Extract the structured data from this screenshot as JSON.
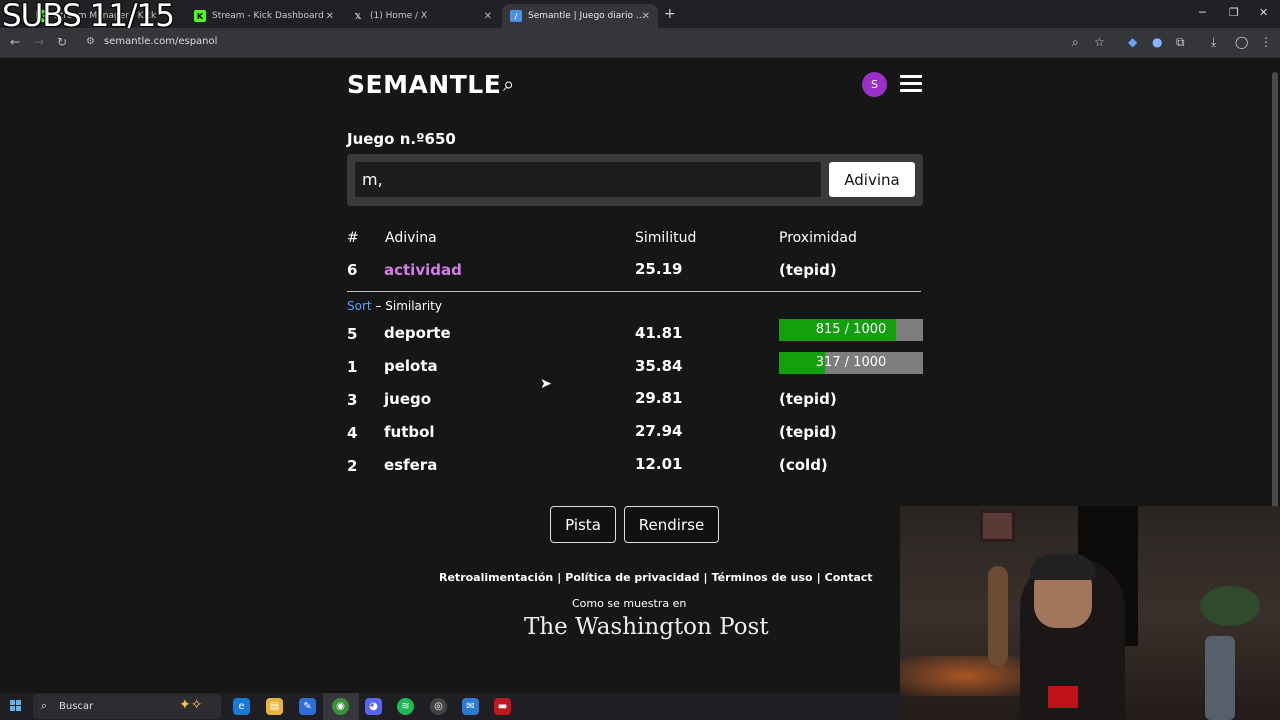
{
  "overlay": {
    "subs": "SUBS 11/15"
  },
  "browser": {
    "tabs": [
      {
        "label": "Stream Manager | Kick",
        "favicon": "kick-icon",
        "color": "#53fc18"
      },
      {
        "label": "Stream - Kick Dashboard",
        "favicon": "kick-icon",
        "color": "#53fc18"
      },
      {
        "label": "(1) Home / X",
        "favicon": "x-icon",
        "color": "#ffffff"
      },
      {
        "label": "Semantle | Juego diario de adivinanzas",
        "favicon": "semantle-icon",
        "color": "#4a90e2",
        "active": true
      }
    ],
    "url": "semantle.com/espanol"
  },
  "header": {
    "logo": "SEMANTLE",
    "avatar_letter": "S"
  },
  "game": {
    "title": "Juego n.º650",
    "input_value": "m,",
    "guess_button": "Adivina"
  },
  "table": {
    "headers": {
      "num": "#",
      "word": "Adivina",
      "similarity": "Similitud",
      "proximity": "Proximidad"
    },
    "latest": {
      "num": "6",
      "word": "actividad",
      "similarity": "25.19",
      "proximity": "(tepid)"
    },
    "sort_link": "Sort",
    "sort_label": "– Similarity",
    "rows": [
      {
        "num": "5",
        "word": "deporte",
        "similarity": "41.81",
        "proximity": "815 / 1000",
        "bar": 815
      },
      {
        "num": "1",
        "word": "pelota",
        "similarity": "35.84",
        "proximity": "317 / 1000",
        "bar": 317
      },
      {
        "num": "3",
        "word": "juego",
        "similarity": "29.81",
        "proximity": "(tepid)"
      },
      {
        "num": "4",
        "word": "futbol",
        "similarity": "27.94",
        "proximity": "(tepid)"
      },
      {
        "num": "2",
        "word": "esfera",
        "similarity": "12.01",
        "proximity": "(cold)"
      }
    ]
  },
  "actions": {
    "hint": "Pista",
    "give_up": "Rendirse"
  },
  "footer": {
    "links": [
      "Retroalimentación",
      "Política de privacidad",
      "Términos de uso",
      "Contact"
    ],
    "shown_in": "Como se muestra en",
    "wapo": "The Washington Post"
  },
  "taskbar": {
    "search_placeholder": "Buscar"
  },
  "colors": {
    "bar_fill": "#13a00f",
    "bar_bg": "#7d7d7d",
    "highlight": "#d37ee6",
    "sort_link": "#5aa3ff"
  }
}
